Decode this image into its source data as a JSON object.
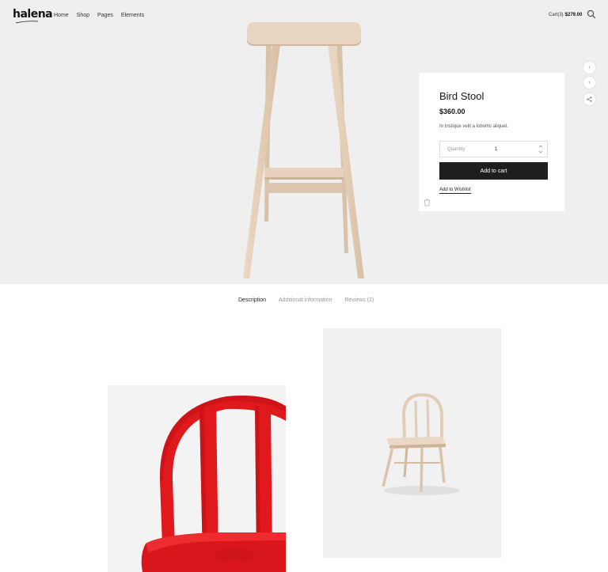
{
  "brand": {
    "logo_text": "halena"
  },
  "nav": {
    "items": [
      "Home",
      "Shop",
      "Pages",
      "Elements"
    ]
  },
  "cart": {
    "label": "Cart(3)",
    "total": "$279.00"
  },
  "product": {
    "title": "Bird Stool",
    "price": "$360.00",
    "description": "In tristique velit a lobortis aliquet.",
    "quantity_label": "Quantity",
    "quantity_value": "1",
    "add_to_cart_label": "Add to cart",
    "wishlist_label": "Add to Wishlist"
  },
  "tabs": [
    "Description",
    "Additional information",
    "Reviews (2)"
  ],
  "icons": {
    "search": "search-icon",
    "prev": "chevron-left-icon",
    "next": "chevron-right-icon",
    "share": "share-icon",
    "cup": "cup-icon"
  },
  "colors": {
    "hero_bg": "#efefef",
    "wood": "#e4cfb9",
    "button_bg": "#1e1e1e",
    "red_chair": "#e0191d"
  }
}
